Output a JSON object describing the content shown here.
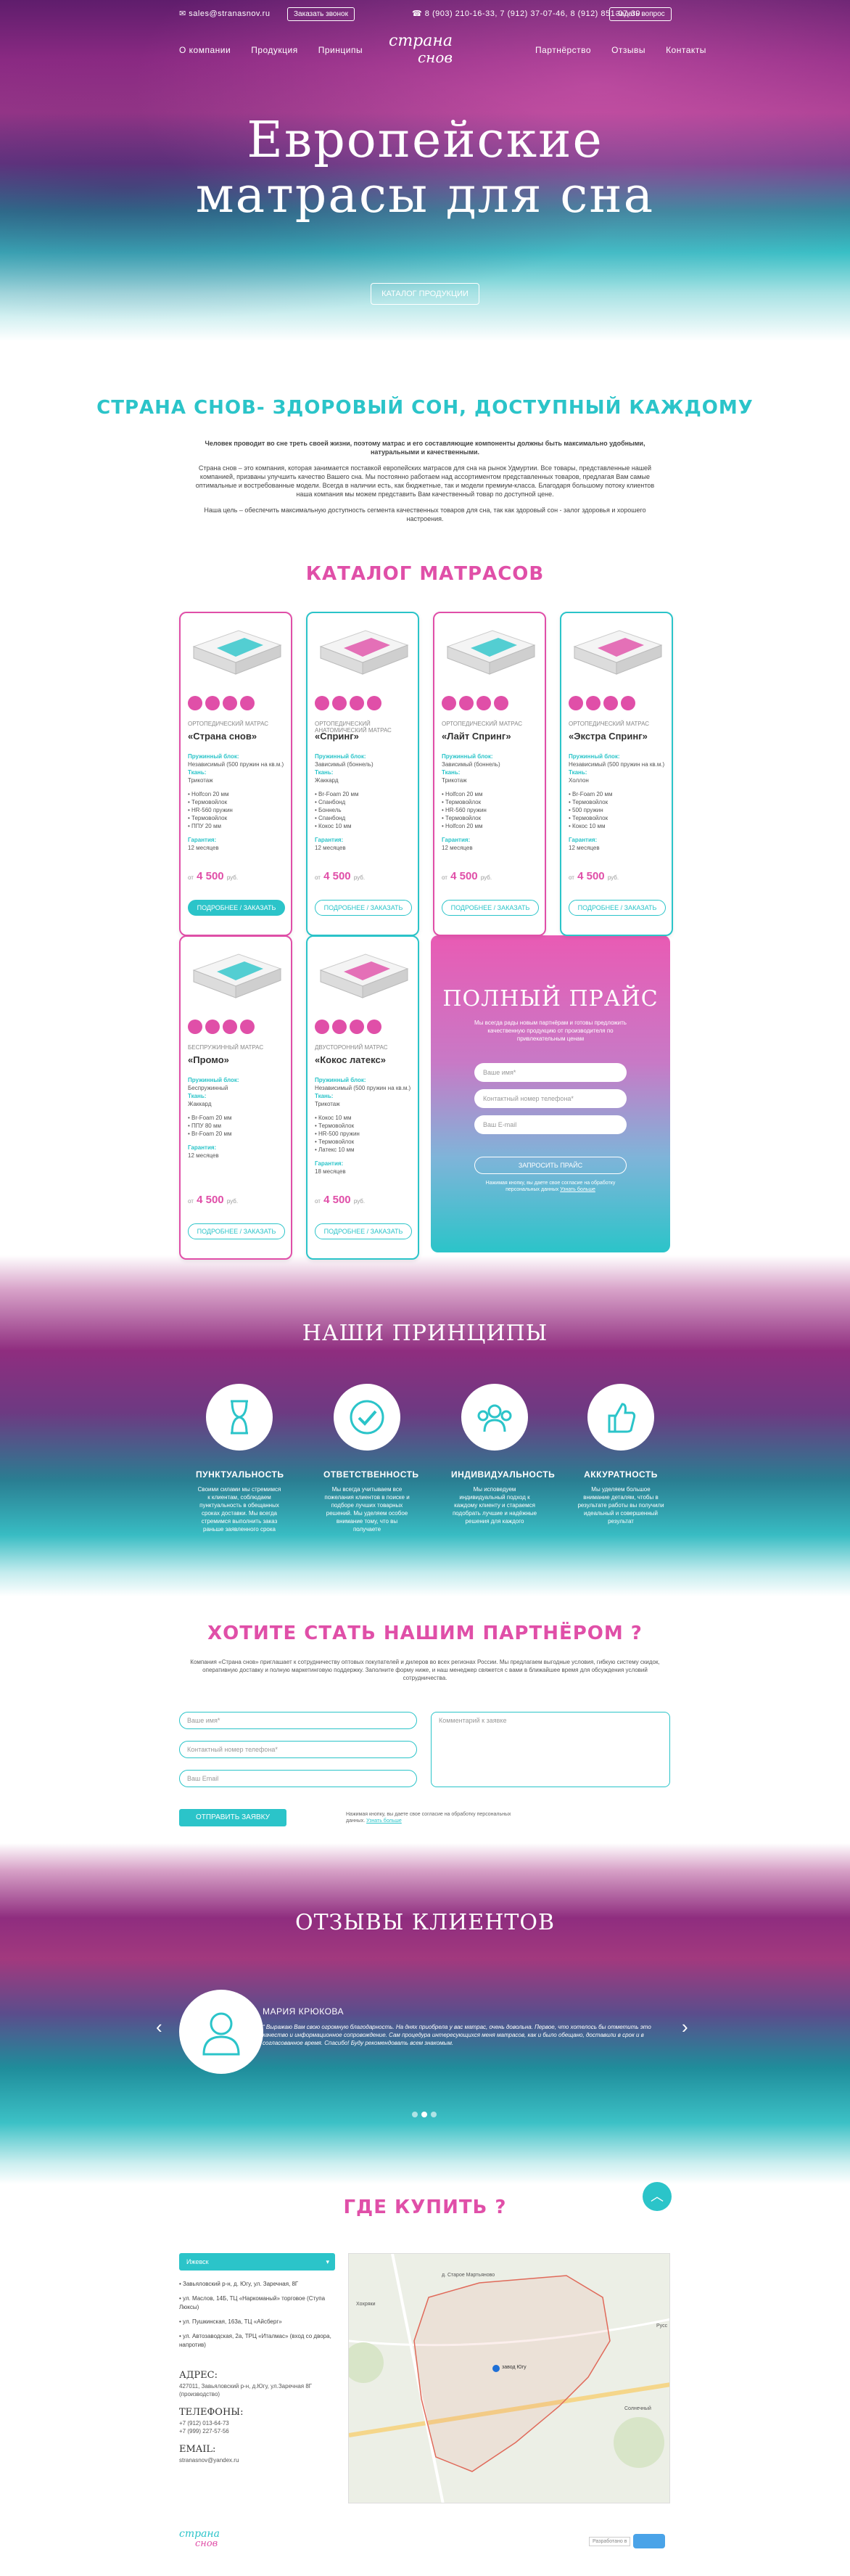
{
  "header": {
    "email": "sales@stranasnov.ru",
    "call_button": "Заказать звонок",
    "phones": "8 (903) 210-16-33, 7 (912) 37-07-46, 8 (912) 851-07-39",
    "callback_button": "Задать вопрос",
    "nav_left": [
      "О компании",
      "Продукция",
      "Принципы"
    ],
    "nav_right": [
      "Партнёрство",
      "Отзывы",
      "Контакты"
    ],
    "logo_line1": "страна",
    "logo_line2": "снов"
  },
  "hero": {
    "title_line1": "Европейские",
    "title_line2": "матрасы для сна",
    "catalog_button": "Каталог продукции"
  },
  "about": {
    "title": "Страна снов- здоровый сон, доступный каждому",
    "p1": "Человек проводит во сне треть своей жизни, поэтому матрас и его составляющие компоненты должны быть максимально удобными, натуральными и качественными.",
    "p2": "Страна снов – это компания, которая занимается поставкой европейских матрасов для сна на рынок Удмуртии. Все товары, представленные нашей компанией, призваны улучшить качество Вашего сна. Мы постоянно работаем над ассортиментом представленных товаров, предлагая Вам самые оптимальные и востребованные модели. Всегда в наличии есть, как бюджетные, так и модели премиум-класса. Благодаря большому потоку клиентов наша компания мы можем представить Вам качественный товар по доступной цене.",
    "p3": "Наша цель – обеспечить максимальную доступность сегмента качественных товаров для сна, так как здоровый сон - залог здоровья и хорошего настроения."
  },
  "catalog": {
    "title": "Каталог матрасов",
    "cards": [
      {
        "type": "Ортопедический матрас",
        "name": "«Страна снов»",
        "spring_label": "Пружинный блок:",
        "spring": "Независимый (500 пружин на кв.м.)",
        "fabric_label": "Ткань:",
        "fabric": "Трикотаж",
        "features": [
          "• Holfcon 20 мм",
          "• Термовойлок",
          "• HR-560 пружин",
          "• Термовойлок",
          "• ППУ 20 мм"
        ],
        "warranty_label": "Гарантия:",
        "warranty": "12 месяцев",
        "price_from": "от",
        "price": "4 500",
        "currency": "руб.",
        "order": "Подробнее / Заказать",
        "filled": true,
        "accent": "pink"
      },
      {
        "type": "Ортопедический анатомический матрас",
        "name": "«Спринг»",
        "spring_label": "Пружинный блок:",
        "spring": "Зависимый (боннель)",
        "fabric_label": "Ткань:",
        "fabric": "Жаккард",
        "features": [
          "• Br-Foam 20 мм",
          "• Спанбонд",
          "• Боннель",
          "• Спанбонд",
          "• Кокос 10 мм"
        ],
        "warranty_label": "Гарантия:",
        "warranty": "12 месяцев",
        "price_from": "от",
        "price": "4 500",
        "currency": "руб.",
        "order": "Подробнее / Заказать",
        "filled": false,
        "accent": "teal"
      },
      {
        "type": "Ортопедический матрас",
        "name": "«Лайт Спринг»",
        "spring_label": "Пружинный блок:",
        "spring": "Зависимый (боннель)",
        "fabric_label": "Ткань:",
        "fabric": "Трикотаж",
        "features": [
          "• Holfcon 20 мм",
          "• Термовойлок",
          "• HR-560 пружин",
          "• Термовойлок",
          "• Holfcon 20 мм"
        ],
        "warranty_label": "Гарантия:",
        "warranty": "12 месяцев",
        "price_from": "от",
        "price": "4 500",
        "currency": "руб.",
        "order": "Подробнее / Заказать",
        "filled": false,
        "accent": "pink"
      },
      {
        "type": "Ортопедический матрас",
        "name": "«Экстра Спринг»",
        "spring_label": "Пружинный блок:",
        "spring": "Независимый (500 пружин на кв.м.)",
        "fabric_label": "Ткань:",
        "fabric": "Холлон",
        "features": [
          "• Br-Foam 20 мм",
          "• Термовойлок",
          "• 500 пружин",
          "• Термовойлок",
          "• Кокос 10 мм"
        ],
        "warranty_label": "Гарантия:",
        "warranty": "12 месяцев",
        "price_from": "от",
        "price": "4 500",
        "currency": "руб.",
        "order": "Подробнее / Заказать",
        "filled": false,
        "accent": "teal"
      },
      {
        "type": "Беспружинный матрас",
        "name": "«Промо»",
        "spring_label": "Пружинный блок:",
        "spring": "Беспружинный",
        "fabric_label": "Ткань:",
        "fabric": "Жаккард",
        "features": [
          "• Br-Foam 20 мм",
          "• ППУ 80 мм",
          "• Br-Foam 20 мм"
        ],
        "warranty_label": "Гарантия:",
        "warranty": "12 месяцев",
        "price_from": "от",
        "price": "4 500",
        "currency": "руб.",
        "order": "Подробнее / Заказать",
        "filled": false,
        "accent": "pink"
      },
      {
        "type": "Двусторонний матрас",
        "name": "«Кокос латекс»",
        "spring_label": "Пружинный блок:",
        "spring": "Независимый (500 пружин на кв.м.)",
        "fabric_label": "Ткань:",
        "fabric": "Трикотаж",
        "features": [
          "• Кокос 10 мм",
          "• Термовойлок",
          "• HR-500 пружин",
          "• Термовойлок",
          "• Латекс 10 мм"
        ],
        "warranty_label": "Гарантия:",
        "warranty": "18 месяцев",
        "price_from": "от",
        "price": "4 500",
        "currency": "руб.",
        "order": "Подробнее / Заказать",
        "filled": false,
        "accent": "teal"
      }
    ],
    "pricelist": {
      "title": "Полный  прайс",
      "text": "Мы всегда рады новым партнёрам и готовы предложить качественную продукцию от производителя по привлекательным ценам",
      "name_ph": "Ваше имя*",
      "phone_ph": "Контактный номер телефона*",
      "email_ph": "Ваш E-mail",
      "button": "Запросить прайс",
      "note": "Нажимая кнопку, вы даете свое согласие на обработку персональных данных",
      "note_link": "Узнать больше"
    }
  },
  "principles": {
    "title": "Наши принципы",
    "items": [
      {
        "icon": "hourglass-icon",
        "title": "Пунктуальность",
        "text": "Своими силами мы стремимся к клиентам, соблюдаем пунктуальность в обещанных сроках доставки. Мы всегда стремимся выполнить заказ раньше заявленного срока"
      },
      {
        "icon": "check-icon",
        "title": "Ответственность",
        "text": "Мы всегда учитываем все пожелания клиентов в поиске и подборе лучших товарных решений. Мы уделяем особое внимание тому, что вы получаете"
      },
      {
        "icon": "people-icon",
        "title": "Индивидуальность",
        "text": "Мы исповедуем индивидуальный подход к каждому клиенту и стараемся подобрать лучшие и надёжные решения для каждого"
      },
      {
        "icon": "thumbs-up-icon",
        "title": "Аккуратность",
        "text": "Мы уделяем большое внимание деталям, чтобы в результате работы вы получили идеальный и совершенный результат"
      }
    ]
  },
  "partner": {
    "title": "Хотите стать нашим партнёром ?",
    "text": "Компания «Страна снов» приглашает к сотрудничеству оптовых покупателей и дилеров во всех регионах России. Мы предлагаем выгодные условия, гибкую систему скидок, оперативную доставку и полную маркетинговую поддержку. Заполните форму ниже, и наш менеджер свяжется с вами в ближайшее время для обсуждения условий сотрудничества.",
    "name_ph": "Ваше имя*",
    "phone_ph": "Контактный номер телефона*",
    "email_ph": "Ваш Email",
    "comment_ph": "Комментарий к заявке",
    "button": "Отправить заявку",
    "note": "Нажимая кнопку, вы даете свое согласие на обработку персональных данных.",
    "note_link": "Узнать больше"
  },
  "reviews": {
    "title": "Отзывы клиентов",
    "name": "Мария Крюкова",
    "text": "Выражаю Вам свою огромную благодарность. На днях приобрела у вас матрас, очень довольна. Первое, что хотелось бы отметить это качество и информационное сопровождение. Сам процедура интересующихся меня матрасов, как и было обещано, доставили в срок и в согласованное время. Спасибо! Буду рекомендовать всем знакомым."
  },
  "wherebuy": {
    "title": "Где купить ?",
    "city": "Ижевск",
    "addresses": [
      "• Завьяловский р-н, д. Югу, ул. Заречная, 8Г",
      "• ул. Маслов, 14Б, ТЦ «Наркоманый» торговое (Ступа Люксы)",
      "• ул. Пушкинская, 163а, ТЦ «Айсберг»",
      "• ул. Автозаводская, 2а, ТРЦ «Италмас» (вход со двора, напротив)"
    ],
    "addr_label": "Адрес:",
    "addr": "427011, Завьяловский р-н, д.Югу, ул.Заречная 8Г (производство)",
    "phone_label": "Телефоны:",
    "phone1": "+7 (912) 013-64-73",
    "phone2": "+7 (999) 227-57-56",
    "email_label": "Email:",
    "email": "stranasnov@yandex.ru",
    "map_labels": [
      "д. Старое Мартьяново",
      "Хохряки",
      "завод Югу",
      "Солнечный",
      "Русс"
    ]
  },
  "footer": {
    "logo_line1": "страна",
    "logo_line2": "снов",
    "badge": "Разработано в"
  },
  "colors": {
    "pink": "#e04fa8",
    "teal": "#2bc4c9",
    "purple": "#8a2a86"
  }
}
